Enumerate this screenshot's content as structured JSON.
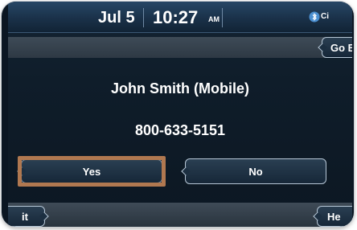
{
  "status_bar": {
    "date": "Jul 5",
    "time": "10:27",
    "ampm": "AM",
    "bluetooth_label": "Ci"
  },
  "navigation": {
    "go_back_label": "Go B",
    "exit_label": "it",
    "help_label": "He"
  },
  "call": {
    "caller_name": "John Smith (Mobile)",
    "caller_number": "800-633-5151"
  },
  "actions": {
    "yes_label": "Yes",
    "no_label": "No"
  },
  "colors": {
    "highlight": "#b07850",
    "button_border": "#b7c7d6",
    "background": "#0f1d2a"
  }
}
